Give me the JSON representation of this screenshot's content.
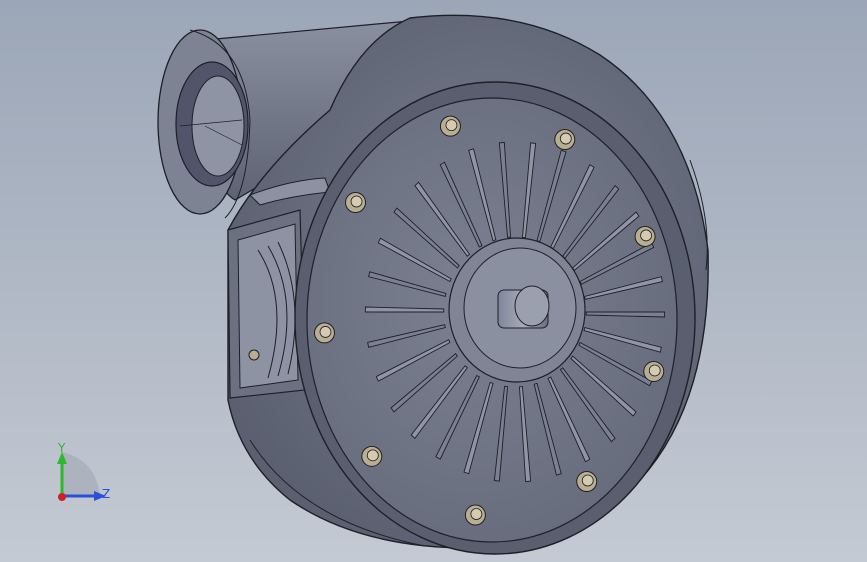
{
  "viewport": {
    "background_top": "#9ba6b7",
    "background_bottom": "#c4cad3"
  },
  "model": {
    "description_name": "centrifugal-blower",
    "body_color": "#6f7484",
    "body_dark": "#4a4e5a",
    "body_light": "#8d92a2",
    "edge_color": "#1e2028",
    "bolt_color": "#b9ae8f",
    "blade_count": 30,
    "bolt_count": 9
  },
  "triad": {
    "y_label": "Y",
    "z_label": "Z",
    "y_color": "#2db82d",
    "z_color": "#2850d8",
    "x_color": "#d02020"
  }
}
